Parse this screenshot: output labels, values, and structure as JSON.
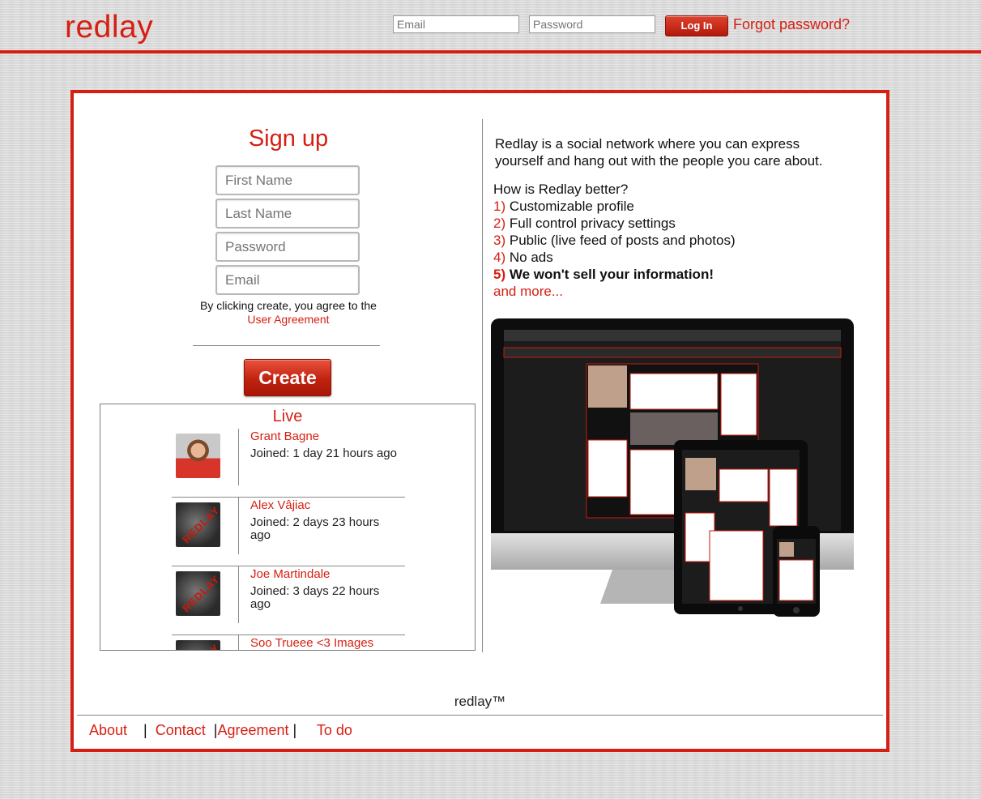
{
  "header": {
    "logo": "redlay",
    "email_placeholder": "Email",
    "password_placeholder": "Password",
    "login_label": "Log In",
    "forgot_label": "Forgot password?"
  },
  "signup": {
    "title": "Sign up",
    "first_name_placeholder": "First Name",
    "last_name_placeholder": "Last Name",
    "password_placeholder": "Password",
    "email_placeholder": "Email",
    "agree_text": "By clicking create, you agree to the",
    "agreement_link": "User Agreement",
    "create_label": "Create"
  },
  "live": {
    "title": "Live",
    "items": [
      {
        "name": "Grant Bagne",
        "joined": "Joined: 1 day 21 hours ago",
        "avatar": "photo"
      },
      {
        "name": "Alex Vâjiac",
        "joined": "Joined: 2 days 23 hours ago",
        "avatar": "redlay-logo"
      },
      {
        "name": "Joe Martindale",
        "joined": "Joined: 3 days 22 hours ago",
        "avatar": "redlay-logo"
      },
      {
        "name": "Soo Trueee <3 Images",
        "joined": "",
        "avatar": "redlay-logo"
      }
    ]
  },
  "info": {
    "intro": "Redlay is a social network where you can express yourself and hang out with the people you care about.",
    "question": "How is Redlay better?",
    "points": [
      {
        "num": "1)",
        "text": "Customizable profile"
      },
      {
        "num": "2)",
        "text": "Full control privacy settings"
      },
      {
        "num": "3)",
        "text": "Public (live feed of posts and photos)"
      },
      {
        "num": "4)",
        "text": "No ads"
      },
      {
        "num": "5)",
        "text": "We won't sell your information!"
      }
    ],
    "more": "and more..."
  },
  "footer": {
    "brand": "redlay™",
    "links": [
      "About",
      "Contact",
      "Agreement",
      "To do"
    ]
  },
  "colors": {
    "brand_red": "#d61f12"
  }
}
